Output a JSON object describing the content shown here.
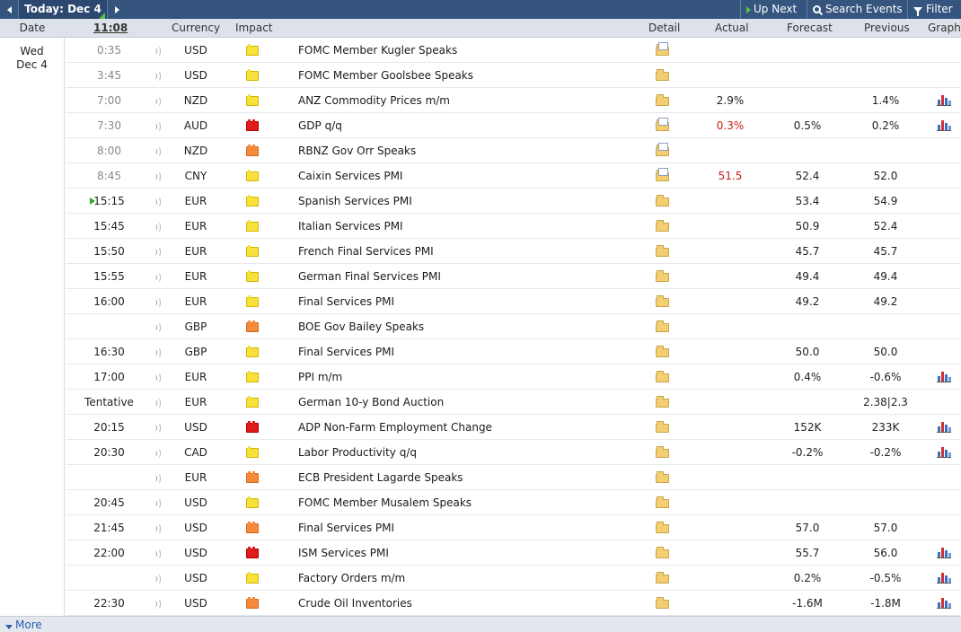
{
  "toolbar": {
    "today_label": "Today: Dec 4",
    "up_next_label": "Up Next",
    "search_label": "Search Events",
    "filter_label": "Filter"
  },
  "header": {
    "date": "Date",
    "time": "11:08",
    "currency": "Currency",
    "impact": "Impact",
    "detail": "Detail",
    "actual": "Actual",
    "forecast": "Forecast",
    "previous": "Previous",
    "graph": "Graph"
  },
  "date_group": {
    "day": "Wed",
    "date": "Dec 4"
  },
  "colors": {
    "toolbar": "#35547e",
    "header": "#dde2ea",
    "actual_worse": "#cc1a1a",
    "live": "#2eaa2e"
  },
  "events": [
    {
      "time": "0:35",
      "currency": "USD",
      "impact": "low",
      "event": "FOMC Member Kugler Speaks",
      "detail_open": true,
      "actual": "",
      "forecast": "",
      "previous": "",
      "graph": false,
      "past": true
    },
    {
      "time": "3:45",
      "currency": "USD",
      "impact": "low",
      "event": "FOMC Member Goolsbee Speaks",
      "detail_open": false,
      "actual": "",
      "forecast": "",
      "previous": "",
      "graph": false,
      "past": true
    },
    {
      "time": "7:00",
      "currency": "NZD",
      "impact": "low",
      "event": "ANZ Commodity Prices m/m",
      "detail_open": false,
      "actual": "2.9%",
      "forecast": "",
      "previous": "1.4%",
      "graph": true,
      "past": true
    },
    {
      "time": "7:30",
      "currency": "AUD",
      "impact": "high",
      "event": "GDP q/q",
      "detail_open": true,
      "actual": "0.3%",
      "actual_red": true,
      "forecast": "0.5%",
      "previous": "0.2%",
      "graph": true,
      "past": true
    },
    {
      "time": "8:00",
      "currency": "NZD",
      "impact": "med",
      "event": "RBNZ Gov Orr Speaks",
      "detail_open": true,
      "actual": "",
      "forecast": "",
      "previous": "",
      "graph": false,
      "past": true
    },
    {
      "time": "8:45",
      "currency": "CNY",
      "impact": "low",
      "event": "Caixin Services PMI",
      "detail_open": true,
      "actual": "51.5",
      "actual_red": true,
      "forecast": "52.4",
      "previous": "52.0",
      "graph": false,
      "past": true
    },
    {
      "time": "15:15",
      "currency": "EUR",
      "impact": "low",
      "event": "Spanish Services PMI",
      "detail_open": false,
      "actual": "",
      "forecast": "53.4",
      "previous": "54.9",
      "graph": false,
      "live": true
    },
    {
      "time": "15:45",
      "currency": "EUR",
      "impact": "low",
      "event": "Italian Services PMI",
      "detail_open": false,
      "actual": "",
      "forecast": "50.9",
      "previous": "52.4",
      "graph": false
    },
    {
      "time": "15:50",
      "currency": "EUR",
      "impact": "low",
      "event": "French Final Services PMI",
      "detail_open": false,
      "actual": "",
      "forecast": "45.7",
      "previous": "45.7",
      "graph": false
    },
    {
      "time": "15:55",
      "currency": "EUR",
      "impact": "low",
      "event": "German Final Services PMI",
      "detail_open": false,
      "actual": "",
      "forecast": "49.4",
      "previous": "49.4",
      "graph": false
    },
    {
      "time": "16:00",
      "currency": "EUR",
      "impact": "low",
      "event": "Final Services PMI",
      "detail_open": false,
      "actual": "",
      "forecast": "49.2",
      "previous": "49.2",
      "graph": false
    },
    {
      "time": "",
      "currency": "GBP",
      "impact": "med",
      "event": "BOE Gov Bailey Speaks",
      "detail_open": false,
      "actual": "",
      "forecast": "",
      "previous": "",
      "graph": false
    },
    {
      "time": "16:30",
      "currency": "GBP",
      "impact": "low",
      "event": "Final Services PMI",
      "detail_open": false,
      "actual": "",
      "forecast": "50.0",
      "previous": "50.0",
      "graph": false
    },
    {
      "time": "17:00",
      "currency": "EUR",
      "impact": "low",
      "event": "PPI m/m",
      "detail_open": false,
      "actual": "",
      "forecast": "0.4%",
      "previous": "-0.6%",
      "graph": true
    },
    {
      "time": "Tentative",
      "currency": "EUR",
      "impact": "low",
      "event": "German 10-y Bond Auction",
      "detail_open": false,
      "actual": "",
      "forecast": "",
      "previous": "2.38|2.3",
      "graph": false
    },
    {
      "time": "20:15",
      "currency": "USD",
      "impact": "high",
      "event": "ADP Non-Farm Employment Change",
      "detail_open": false,
      "actual": "",
      "forecast": "152K",
      "previous": "233K",
      "graph": true
    },
    {
      "time": "20:30",
      "currency": "CAD",
      "impact": "low",
      "event": "Labor Productivity q/q",
      "detail_open": false,
      "actual": "",
      "forecast": "-0.2%",
      "previous": "-0.2%",
      "graph": true
    },
    {
      "time": "",
      "currency": "EUR",
      "impact": "med",
      "event": "ECB President Lagarde Speaks",
      "detail_open": false,
      "actual": "",
      "forecast": "",
      "previous": "",
      "graph": false
    },
    {
      "time": "20:45",
      "currency": "USD",
      "impact": "low",
      "event": "FOMC Member Musalem Speaks",
      "detail_open": false,
      "actual": "",
      "forecast": "",
      "previous": "",
      "graph": false
    },
    {
      "time": "21:45",
      "currency": "USD",
      "impact": "med",
      "event": "Final Services PMI",
      "detail_open": false,
      "actual": "",
      "forecast": "57.0",
      "previous": "57.0",
      "graph": false
    },
    {
      "time": "22:00",
      "currency": "USD",
      "impact": "high",
      "event": "ISM Services PMI",
      "detail_open": false,
      "actual": "",
      "forecast": "55.7",
      "previous": "56.0",
      "graph": true
    },
    {
      "time": "",
      "currency": "USD",
      "impact": "low",
      "event": "Factory Orders m/m",
      "detail_open": false,
      "actual": "",
      "forecast": "0.2%",
      "previous": "-0.5%",
      "graph": true
    },
    {
      "time": "22:30",
      "currency": "USD",
      "impact": "med",
      "event": "Crude Oil Inventories",
      "detail_open": false,
      "actual": "",
      "forecast": "-1.6M",
      "previous": "-1.8M",
      "graph": true
    }
  ],
  "footer": {
    "more_label": "More"
  }
}
